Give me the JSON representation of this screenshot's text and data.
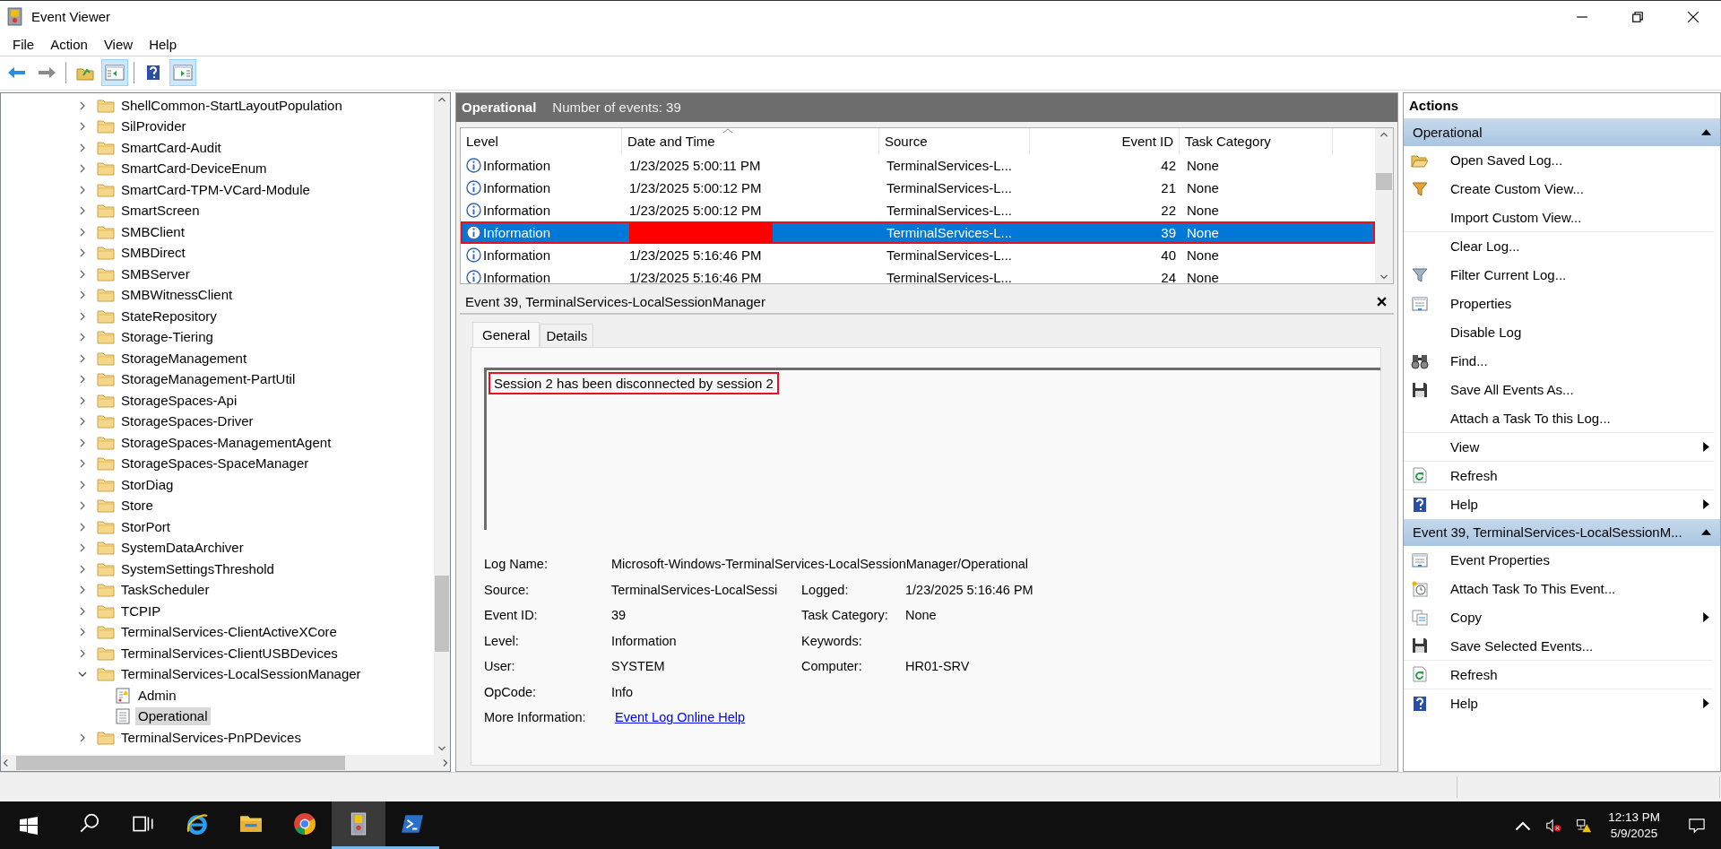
{
  "window": {
    "title": "Event Viewer"
  },
  "menu": [
    "File",
    "Action",
    "View",
    "Help"
  ],
  "toolbar": [
    {
      "kind": "back",
      "pressed": false
    },
    {
      "kind": "forward",
      "pressed": false
    },
    {
      "kind": "separator"
    },
    {
      "kind": "up",
      "pressed": false
    },
    {
      "kind": "console-tree",
      "pressed": true
    },
    {
      "kind": "separator"
    },
    {
      "kind": "help",
      "pressed": false
    },
    {
      "kind": "action-pane",
      "pressed": true
    }
  ],
  "tree": {
    "items": [
      {
        "label": "ShellCommon-StartLayoutPopulation",
        "kind": "folder",
        "expanded": false,
        "selected": false
      },
      {
        "label": "SilProvider",
        "kind": "folder",
        "expanded": false,
        "selected": false
      },
      {
        "label": "SmartCard-Audit",
        "kind": "folder",
        "expanded": false,
        "selected": false
      },
      {
        "label": "SmartCard-DeviceEnum",
        "kind": "folder",
        "expanded": false,
        "selected": false
      },
      {
        "label": "SmartCard-TPM-VCard-Module",
        "kind": "folder",
        "expanded": false,
        "selected": false
      },
      {
        "label": "SmartScreen",
        "kind": "folder",
        "expanded": false,
        "selected": false
      },
      {
        "label": "SMBClient",
        "kind": "folder",
        "expanded": false,
        "selected": false
      },
      {
        "label": "SMBDirect",
        "kind": "folder",
        "expanded": false,
        "selected": false
      },
      {
        "label": "SMBServer",
        "kind": "folder",
        "expanded": false,
        "selected": false
      },
      {
        "label": "SMBWitnessClient",
        "kind": "folder",
        "expanded": false,
        "selected": false
      },
      {
        "label": "StateRepository",
        "kind": "folder",
        "expanded": false,
        "selected": false
      },
      {
        "label": "Storage-Tiering",
        "kind": "folder",
        "expanded": false,
        "selected": false
      },
      {
        "label": "StorageManagement",
        "kind": "folder",
        "expanded": false,
        "selected": false
      },
      {
        "label": "StorageManagement-PartUtil",
        "kind": "folder",
        "expanded": false,
        "selected": false
      },
      {
        "label": "StorageSpaces-Api",
        "kind": "folder",
        "expanded": false,
        "selected": false
      },
      {
        "label": "StorageSpaces-Driver",
        "kind": "folder",
        "expanded": false,
        "selected": false
      },
      {
        "label": "StorageSpaces-ManagementAgent",
        "kind": "folder",
        "expanded": false,
        "selected": false
      },
      {
        "label": "StorageSpaces-SpaceManager",
        "kind": "folder",
        "expanded": false,
        "selected": false
      },
      {
        "label": "StorDiag",
        "kind": "folder",
        "expanded": false,
        "selected": false
      },
      {
        "label": "Store",
        "kind": "folder",
        "expanded": false,
        "selected": false
      },
      {
        "label": "StorPort",
        "kind": "folder",
        "expanded": false,
        "selected": false
      },
      {
        "label": "SystemDataArchiver",
        "kind": "folder",
        "expanded": false,
        "selected": false
      },
      {
        "label": "SystemSettingsThreshold",
        "kind": "folder",
        "expanded": false,
        "selected": false
      },
      {
        "label": "TaskScheduler",
        "kind": "folder",
        "expanded": false,
        "selected": false
      },
      {
        "label": "TCPIP",
        "kind": "folder",
        "expanded": false,
        "selected": false
      },
      {
        "label": "TerminalServices-ClientActiveXCore",
        "kind": "folder",
        "expanded": false,
        "selected": false
      },
      {
        "label": "TerminalServices-ClientUSBDevices",
        "kind": "folder",
        "expanded": false,
        "selected": false
      },
      {
        "label": "TerminalServices-LocalSessionManager",
        "kind": "folder",
        "expanded": true,
        "selected": false,
        "children": [
          {
            "label": "Admin",
            "kind": "admin-log",
            "selected": false
          },
          {
            "label": "Operational",
            "kind": "log",
            "selected": true
          }
        ]
      },
      {
        "label": "TerminalServices-PnPDevices",
        "kind": "folder",
        "expanded": false,
        "selected": false
      }
    ]
  },
  "events": {
    "title": "Operational",
    "count": "Number of events: 39",
    "columns": [
      {
        "label": "Level",
        "sorted": false
      },
      {
        "label": "Date and Time",
        "sorted": true
      },
      {
        "label": "Source",
        "sorted": false
      },
      {
        "label": "Event ID",
        "sorted": false
      },
      {
        "label": "Task Category",
        "sorted": false
      }
    ],
    "rows": [
      {
        "level": "Information",
        "date": "1/23/2025 5:00:11 PM",
        "source": "TerminalServices-L...",
        "event_id": "42",
        "task_category": "None",
        "selected": false,
        "outlined": false,
        "redacted": false
      },
      {
        "level": "Information",
        "date": "1/23/2025 5:00:12 PM",
        "source": "TerminalServices-L...",
        "event_id": "21",
        "task_category": "None",
        "selected": false,
        "outlined": false,
        "redacted": false
      },
      {
        "level": "Information",
        "date": "1/23/2025 5:00:12 PM",
        "source": "TerminalServices-L...",
        "event_id": "22",
        "task_category": "None",
        "selected": false,
        "outlined": false,
        "redacted": false
      },
      {
        "level": "Information",
        "source": "TerminalServices-L...",
        "event_id": "39",
        "task_category": "None",
        "selected": true,
        "outlined": true,
        "redacted": true
      },
      {
        "level": "Information",
        "date": "1/23/2025 5:16:46 PM",
        "source": "TerminalServices-L...",
        "event_id": "40",
        "task_category": "None",
        "selected": false,
        "outlined": false,
        "redacted": false
      },
      {
        "level": "Information",
        "date": "1/23/2025 5:16:46 PM",
        "source": "TerminalServices-L...",
        "event_id": "24",
        "task_category": "None",
        "selected": false,
        "outlined": false,
        "redacted": false
      }
    ]
  },
  "detail": {
    "title": "Event 39, TerminalServices-LocalSessionManager",
    "tabs": [
      {
        "label": "General",
        "selected": true
      },
      {
        "label": "Details",
        "selected": false
      }
    ],
    "message": {
      "text": "Session 2 has been disconnected by session 2",
      "outlined": true
    },
    "fields": [
      {
        "label": "Log Name:",
        "value": "Microsoft-Windows-TerminalServices-LocalSessionManager/Operational"
      },
      {
        "label": "Source:",
        "value": "TerminalServices-LocalSessi",
        "label_2": "Logged:",
        "value_2": "1/23/2025 5:16:46 PM"
      },
      {
        "label": "Event ID:",
        "value": "39",
        "label_2": "Task Category:",
        "value_2": "None"
      },
      {
        "label": "Level:",
        "value": "Information",
        "label_2": "Keywords:"
      },
      {
        "label": "User:",
        "value": "SYSTEM",
        "label_2": "Computer:",
        "value_2": "HR01-SRV"
      },
      {
        "label": "OpCode:",
        "value": "Info"
      },
      {
        "label": "More Information:",
        "value": "Event Log Online Help",
        "kind": "link"
      }
    ]
  },
  "actions": {
    "title": "Actions",
    "sections": [
      {
        "title": "Operational",
        "expanded": true,
        "items": [
          {
            "label": "Open Saved Log...",
            "kind": "open-folder",
            "submenu": false,
            "separator": false
          },
          {
            "label": "Create Custom View...",
            "kind": "funnel-star",
            "submenu": false,
            "separator": false
          },
          {
            "label": "Import Custom View...",
            "kind": "none",
            "submenu": false,
            "separator": true
          },
          {
            "label": "Clear Log...",
            "kind": "none",
            "submenu": false,
            "separator": false
          },
          {
            "label": "Filter Current Log...",
            "kind": "funnel",
            "submenu": false,
            "separator": false
          },
          {
            "label": "Properties",
            "kind": "properties",
            "submenu": false,
            "separator": false
          },
          {
            "label": "Disable Log",
            "kind": "none",
            "submenu": false,
            "separator": false
          },
          {
            "label": "Find...",
            "kind": "binoculars",
            "submenu": false,
            "separator": false
          },
          {
            "label": "Save All Events As...",
            "kind": "floppy",
            "submenu": false,
            "separator": false
          },
          {
            "label": "Attach a Task To this Log...",
            "kind": "none",
            "submenu": false,
            "separator": true
          },
          {
            "label": "View",
            "kind": "none",
            "submenu": true,
            "separator": true
          },
          {
            "label": "Refresh",
            "kind": "refresh",
            "submenu": false,
            "separator": true
          },
          {
            "label": "Help",
            "kind": "help",
            "submenu": true,
            "separator": false
          }
        ]
      },
      {
        "title": "Event 39, TerminalServices-LocalSessionM...",
        "expanded": true,
        "items": [
          {
            "label": "Event Properties",
            "kind": "properties",
            "submenu": false,
            "separator": false
          },
          {
            "label": "Attach Task To This Event...",
            "kind": "clock-task",
            "submenu": false,
            "separator": false
          },
          {
            "label": "Copy",
            "kind": "copy",
            "submenu": true,
            "separator": false
          },
          {
            "label": "Save Selected Events...",
            "kind": "floppy",
            "submenu": false,
            "separator": true
          },
          {
            "label": "Refresh",
            "kind": "refresh",
            "submenu": false,
            "separator": true
          },
          {
            "label": "Help",
            "kind": "help",
            "submenu": true,
            "separator": false
          }
        ]
      }
    ]
  },
  "taskbar": {
    "apps": [
      {
        "kind": "search",
        "selected": false,
        "running": false
      },
      {
        "kind": "task-view",
        "selected": false,
        "running": false
      },
      {
        "kind": "browser-e",
        "selected": false,
        "running": false
      },
      {
        "kind": "explorer",
        "selected": false,
        "running": false
      },
      {
        "kind": "chrome",
        "selected": false,
        "running": false
      },
      {
        "kind": "event-viewer",
        "selected": true,
        "running": true
      },
      {
        "kind": "powershell",
        "selected": false,
        "running": true
      }
    ],
    "time": "12:13 PM",
    "date": "5/9/2025"
  }
}
